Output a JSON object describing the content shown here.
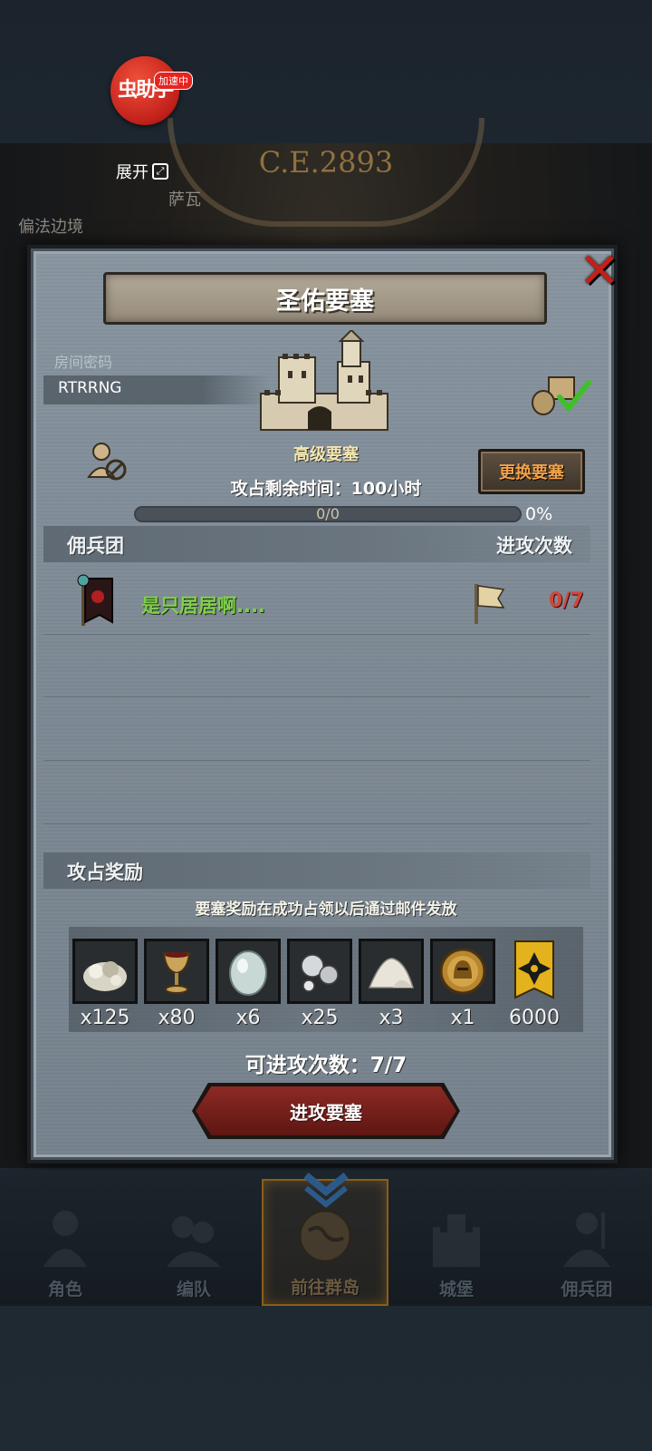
{
  "overlay": {
    "badge_text": "虫助手",
    "badge_tag": "加速中",
    "expand_label": "展开"
  },
  "background": {
    "year": "C.E.2893",
    "labels": [
      "偏法边境",
      "萨瓦"
    ]
  },
  "modal": {
    "title": "圣佑要塞",
    "room_label": "房间密码",
    "room_code": "RTRRNG",
    "fortress_type": "高级要塞",
    "swap_button": "更换要塞",
    "time_left": "攻占剩余时间：100小时",
    "progress": {
      "text": "0/0",
      "value": 0,
      "percent": "0%"
    },
    "mercenary_header": "佣兵团",
    "attack_count_header": "进攻次数",
    "mercenaries": [
      {
        "name": "是只居居啊....",
        "count": "0/7"
      }
    ],
    "rewards_header": "攻占奖励",
    "reward_note": "要塞奖励在成功占领以后通过邮件发放",
    "rewards": [
      {
        "icon": "silver-ore-icon",
        "qty": "x125"
      },
      {
        "icon": "goblet-icon",
        "qty": "x80"
      },
      {
        "icon": "moonstone-icon",
        "qty": "x6"
      },
      {
        "icon": "mercury-icon",
        "qty": "x25"
      },
      {
        "icon": "salt-pile-icon",
        "qty": "x3"
      },
      {
        "icon": "knight-coin-icon",
        "qty": "x1"
      },
      {
        "icon": "guild-banner-icon",
        "qty": "6000"
      }
    ],
    "remaining_attacks": "可进攻次数：7/7",
    "attack_button": "进攻要塞"
  },
  "bottom_nav": {
    "items": [
      {
        "label": "角色",
        "icon": "knight-icon"
      },
      {
        "label": "编队",
        "icon": "formation-icon"
      },
      {
        "label": "前往群岛",
        "icon": "globe-icon",
        "active": true
      },
      {
        "label": "城堡",
        "icon": "castle-icon"
      },
      {
        "label": "佣兵团",
        "icon": "mercenary-icon"
      }
    ]
  },
  "colors": {
    "accent_gold": "#c7a04a",
    "name_green": "#7ed04a",
    "count_red": "#d2453a",
    "swap_orange": "#f3a24a"
  }
}
